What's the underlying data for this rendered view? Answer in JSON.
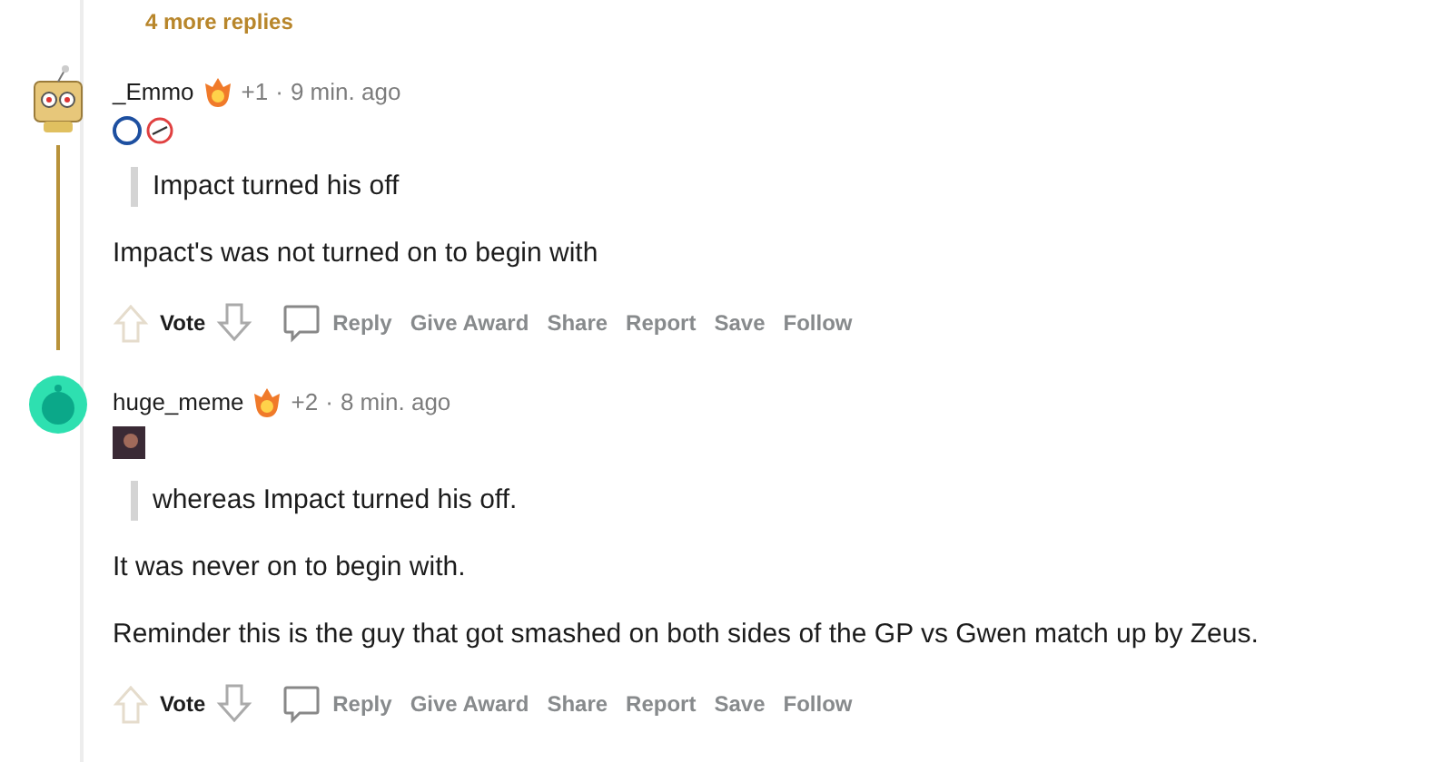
{
  "more_replies": "4 more replies",
  "comments": [
    {
      "username": "_Emmo",
      "award_count": "+1",
      "separator": "·",
      "time": "9 min. ago",
      "avatar": {
        "kind": "robot"
      },
      "flairs": [
        {
          "kind": "crest"
        },
        {
          "kind": "logo"
        }
      ],
      "thread_highlighted": true,
      "quote": "Impact turned his off",
      "paragraphs": [
        "Impact's was not turned on to begin with"
      ],
      "vote": "Vote",
      "actions": [
        "Reply",
        "Give Award",
        "Share",
        "Report",
        "Save",
        "Follow"
      ]
    },
    {
      "username": "huge_meme",
      "award_count": "+2",
      "separator": "·",
      "time": "8 min. ago",
      "avatar": {
        "kind": "snoo"
      },
      "flairs": [
        {
          "kind": "portrait"
        }
      ],
      "thread_highlighted": false,
      "quote": "whereas Impact turned his off.",
      "paragraphs": [
        "It was never on to begin with.",
        "Reminder this is the guy that got smashed on both sides of the GP vs Gwen match up by Zeus."
      ],
      "vote": "Vote",
      "actions": [
        "Reply",
        "Give Award",
        "Share",
        "Report",
        "Save",
        "Follow"
      ]
    }
  ]
}
